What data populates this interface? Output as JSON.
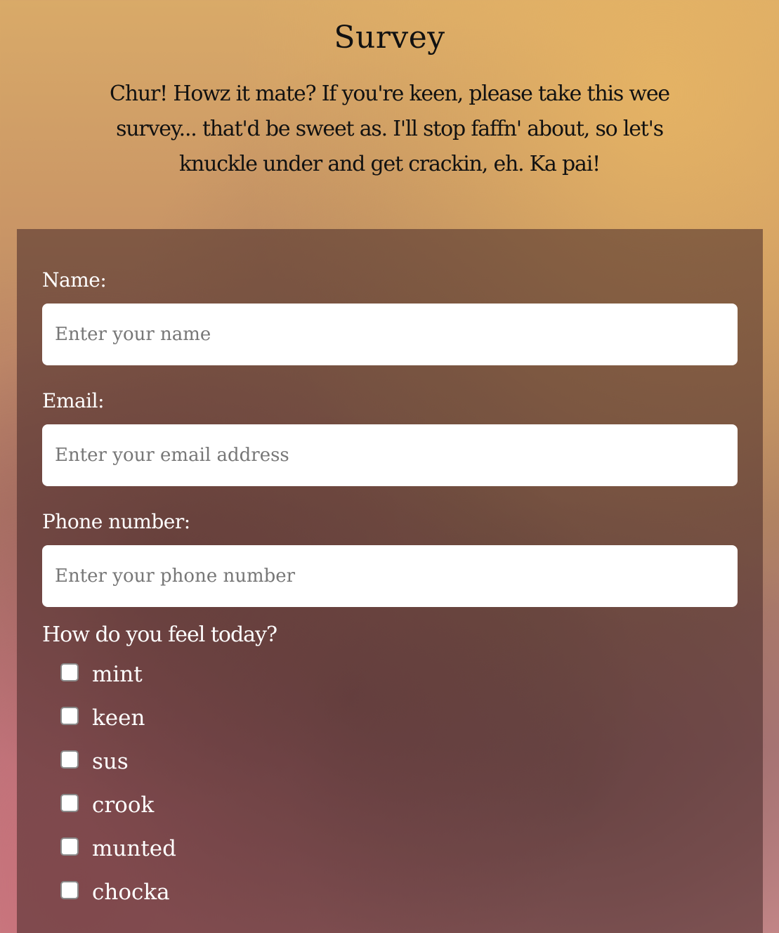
{
  "header": {
    "title": "Survey",
    "intro": "Chur! Howz it mate? If you're keen, please take this wee survey... that'd be sweet as. I'll stop faffn' about, so let's knuckle under and get crackin, eh. Ka pai!"
  },
  "form": {
    "name": {
      "label": "Name:",
      "placeholder": "Enter your name",
      "value": ""
    },
    "email": {
      "label": "Email:",
      "placeholder": "Enter your email address",
      "value": ""
    },
    "phone": {
      "label": "Phone number:",
      "placeholder": "Enter your phone number",
      "value": ""
    },
    "feelings": {
      "question": "How do you feel today?",
      "options": [
        {
          "label": "mint",
          "checked": false
        },
        {
          "label": "keen",
          "checked": false
        },
        {
          "label": "sus",
          "checked": false
        },
        {
          "label": "crook",
          "checked": false
        },
        {
          "label": "munted",
          "checked": false
        },
        {
          "label": "chocka",
          "checked": false
        }
      ]
    }
  }
}
